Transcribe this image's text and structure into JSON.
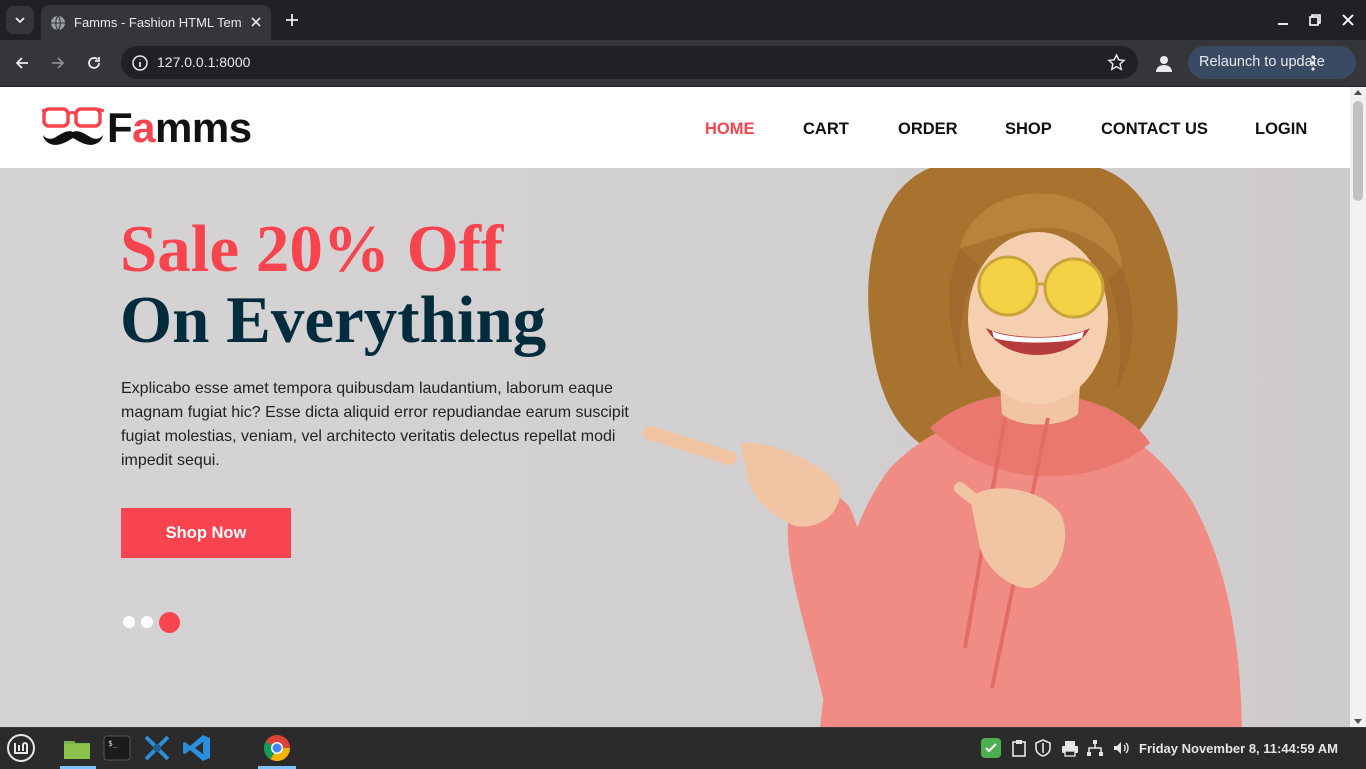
{
  "browser": {
    "tab_title": "Famms - Fashion HTML Template",
    "url": "127.0.0.1:8000",
    "relaunch_label": "Relaunch to update"
  },
  "site": {
    "logo": {
      "prefix": "F",
      "accent": "a",
      "suffix": "mms"
    },
    "nav": [
      {
        "label": "HOME",
        "active": true
      },
      {
        "label": "CART",
        "active": false
      },
      {
        "label": "ORDER",
        "active": false
      },
      {
        "label": "SHOP",
        "active": false
      },
      {
        "label": "CONTACT US",
        "active": false
      },
      {
        "label": "LOGIN",
        "active": false
      }
    ],
    "hero": {
      "headline_1": "Sale 20% Off",
      "headline_2": "On Everything",
      "description": "Explicabo esse amet tempora quibusdam laudantium, laborum eaque magnam fugiat hic? Esse dicta aliquid error repudiandae earum suscipit fugiat molestias, veniam, vel architecto veritatis delectus repellat modi impedit sequi.",
      "cta_label": "Shop Now",
      "carousel_active_index": 2,
      "carousel_count": 3
    },
    "colors": {
      "accent": "#f7444e",
      "dark": "#002c3e"
    }
  },
  "taskbar": {
    "clock": "Friday November  8, 11:44:59 AM",
    "apps": [
      "menu-icon",
      "files-icon",
      "terminal-icon",
      "network-tool-icon",
      "vscode-icon",
      "chrome-icon"
    ]
  }
}
